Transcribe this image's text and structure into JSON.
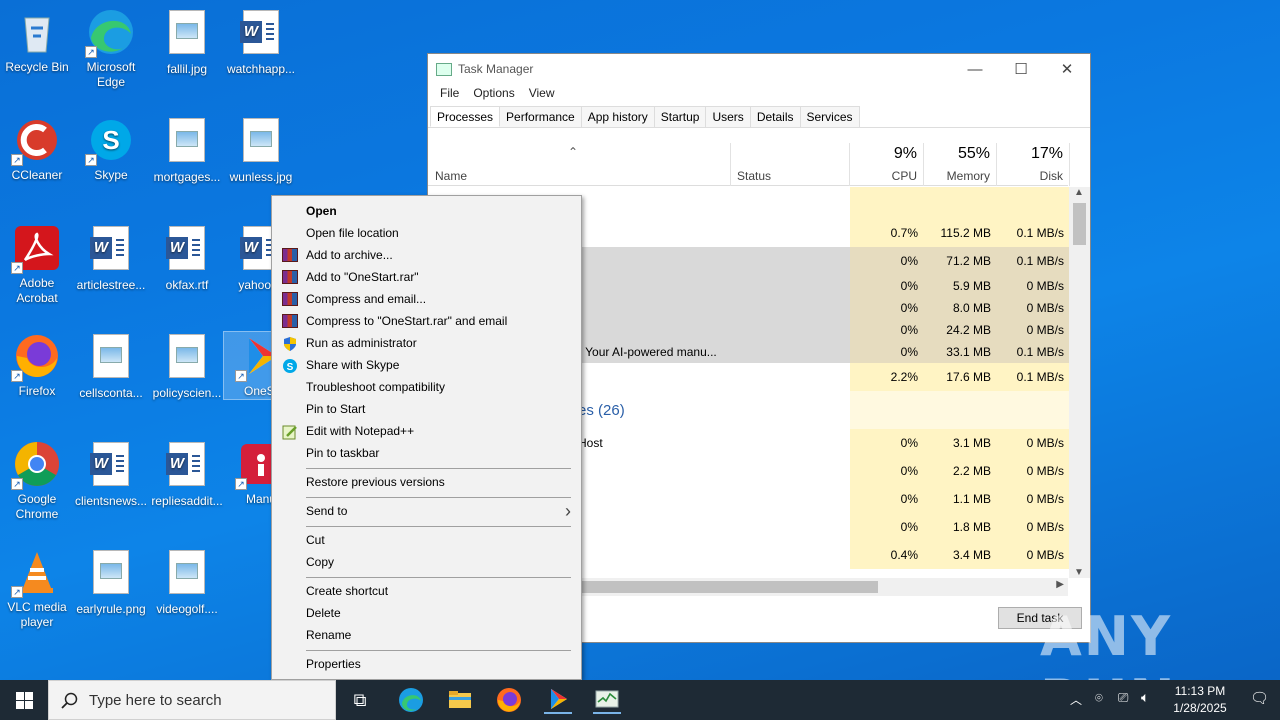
{
  "desktop": {
    "icons": [
      {
        "label": "Recycle Bin",
        "kind": "recycle-bin"
      },
      {
        "label": "Microsoft Edge",
        "kind": "edge"
      },
      {
        "label": "fallil.jpg",
        "kind": "image"
      },
      {
        "label": "watchhapp...",
        "kind": "word"
      },
      {
        "label": "CCleaner",
        "kind": "ccleaner"
      },
      {
        "label": "Skype",
        "kind": "skype"
      },
      {
        "label": "mortgages...",
        "kind": "image"
      },
      {
        "label": "wunless.jpg",
        "kind": "image"
      },
      {
        "label": "Adobe Acrobat",
        "kind": "acrobat"
      },
      {
        "label": "articlestree...",
        "kind": "word"
      },
      {
        "label": "okfax.rtf",
        "kind": "word"
      },
      {
        "label": "yahooch",
        "kind": "word"
      },
      {
        "label": "Firefox",
        "kind": "firefox"
      },
      {
        "label": "cellsconta...",
        "kind": "image"
      },
      {
        "label": "policyscien...",
        "kind": "image"
      },
      {
        "label": "OneSt",
        "kind": "onestart"
      },
      {
        "label": "Google Chrome",
        "kind": "chrome"
      },
      {
        "label": "clientsnews...",
        "kind": "word"
      },
      {
        "label": "repliesaddit...",
        "kind": "word"
      },
      {
        "label": "Manu",
        "kind": "manual"
      },
      {
        "label": "VLC media player",
        "kind": "vlc"
      },
      {
        "label": "earlyrule.png",
        "kind": "image"
      },
      {
        "label": "videogolf....",
        "kind": "image"
      }
    ]
  },
  "task_manager": {
    "title": "Task Manager",
    "window_buttons": {
      "minimize": "—",
      "maximize": "☐",
      "close": "✕"
    },
    "menu": [
      "File",
      "Options",
      "View"
    ],
    "tabs": [
      "Processes",
      "Performance",
      "App history",
      "Startup",
      "Users",
      "Details",
      "Services"
    ],
    "active_tab": "Processes",
    "columns": {
      "name": "Name",
      "status": "Status",
      "cpu": {
        "pct": "9%",
        "label": "CPU"
      },
      "memory": {
        "pct": "55%",
        "label": "Memory"
      },
      "disk": {
        "pct": "17%",
        "label": "Disk"
      }
    },
    "rows": [
      {
        "name": "",
        "cpu": "",
        "mem": "",
        "disk": "",
        "h": 32,
        "hl": false
      },
      {
        "name": "",
        "cpu": "0.7%",
        "mem": "115.2 MB",
        "disk": "0.1 MB/s",
        "h": 28,
        "hl": false
      },
      {
        "name": "",
        "cpu": "0%",
        "mem": "71.2 MB",
        "disk": "0.1 MB/s",
        "h": 28,
        "hl": true
      },
      {
        "name": "",
        "cpu": "0%",
        "mem": "5.9 MB",
        "disk": "0 MB/s",
        "h": 22,
        "hl": true
      },
      {
        "name": "",
        "cpu": "0%",
        "mem": "8.0 MB",
        "disk": "0 MB/s",
        "h": 22,
        "hl": true
      },
      {
        "name": "",
        "cpu": "0%",
        "mem": "24.2 MB",
        "disk": "0 MB/s",
        "h": 22,
        "hl": true
      },
      {
        "name": "- Your AI-powered manu...",
        "cpu": "0%",
        "mem": "33.1 MB",
        "disk": "0.1 MB/s",
        "h": 22,
        "hl": true
      },
      {
        "name": "",
        "cpu": "2.2%",
        "mem": "17.6 MB",
        "disk": "0.1 MB/s",
        "h": 28,
        "hl": false
      },
      {
        "name": "es (26)",
        "cpu": "",
        "mem": "",
        "disk": "",
        "h": 38,
        "hl": false,
        "group": true
      },
      {
        "name": "Host",
        "cpu": "0%",
        "mem": "3.1 MB",
        "disk": "0 MB/s",
        "h": 28,
        "hl": false
      },
      {
        "name": "",
        "cpu": "0%",
        "mem": "2.2 MB",
        "disk": "0 MB/s",
        "h": 28,
        "hl": false
      },
      {
        "name": "",
        "cpu": "0%",
        "mem": "1.1 MB",
        "disk": "0 MB/s",
        "h": 28,
        "hl": false
      },
      {
        "name": "",
        "cpu": "0%",
        "mem": "1.8 MB",
        "disk": "0 MB/s",
        "h": 28,
        "hl": false
      },
      {
        "name": "",
        "cpu": "0.4%",
        "mem": "3.4 MB",
        "disk": "0 MB/s",
        "h": 28,
        "hl": false
      }
    ],
    "end_task": "End task"
  },
  "context_menu": {
    "items": [
      {
        "label": "Open",
        "bold": true,
        "icon": ""
      },
      {
        "label": "Open file location",
        "icon": ""
      },
      {
        "label": "Add to archive...",
        "icon": "winrar-icon"
      },
      {
        "label": "Add to \"OneStart.rar\"",
        "icon": "winrar-icon"
      },
      {
        "label": "Compress and email...",
        "icon": "winrar-icon"
      },
      {
        "label": "Compress to \"OneStart.rar\" and email",
        "icon": "winrar-icon"
      },
      {
        "label": "Run as administrator",
        "icon": "shield-icon"
      },
      {
        "label": "Share with Skype",
        "icon": "skype-icon"
      },
      {
        "label": "Troubleshoot compatibility",
        "icon": ""
      },
      {
        "label": "Pin to Start",
        "icon": ""
      },
      {
        "label": "Edit with Notepad++",
        "icon": "notepadpp-icon"
      },
      {
        "label": "Pin to taskbar",
        "icon": ""
      },
      {
        "sep": true
      },
      {
        "label": "Restore previous versions",
        "icon": ""
      },
      {
        "sep": true
      },
      {
        "label": "Send to",
        "icon": "",
        "submenu": true
      },
      {
        "sep": true
      },
      {
        "label": "Cut",
        "icon": ""
      },
      {
        "label": "Copy",
        "icon": ""
      },
      {
        "sep": true
      },
      {
        "label": "Create shortcut",
        "icon": ""
      },
      {
        "label": "Delete",
        "icon": ""
      },
      {
        "label": "Rename",
        "icon": ""
      },
      {
        "sep": true
      },
      {
        "label": "Properties",
        "icon": ""
      }
    ]
  },
  "taskbar": {
    "search_placeholder": "Type here to search",
    "time": "11:13 PM",
    "date": "1/28/2025"
  },
  "watermark": "ANY RUN"
}
